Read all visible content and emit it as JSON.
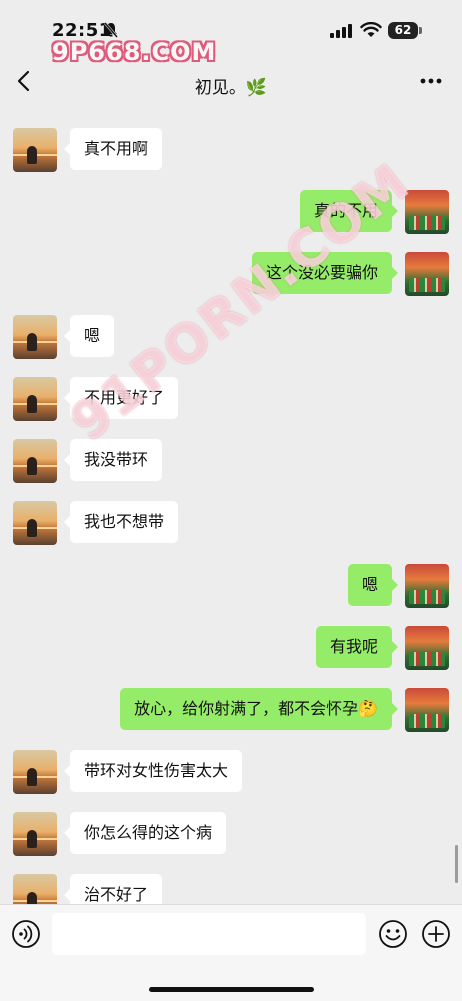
{
  "status_bar": {
    "time": "22:51",
    "battery": "62",
    "watermark": "9P668.COM"
  },
  "nav": {
    "title": "初见。🌿"
  },
  "watermark_diagonal": "91PORN.COM",
  "messages": [
    {
      "side": "left",
      "text": "真不用啊"
    },
    {
      "side": "right",
      "text": "真的不用"
    },
    {
      "side": "right",
      "text": "这个没必要骗你"
    },
    {
      "side": "left",
      "text": "嗯"
    },
    {
      "side": "left",
      "text": "不用更好了"
    },
    {
      "side": "left",
      "text": "我没带环"
    },
    {
      "side": "left",
      "text": "我也不想带"
    },
    {
      "side": "right",
      "text": "嗯"
    },
    {
      "side": "right",
      "text": "有我呢"
    },
    {
      "side": "right",
      "text": "放心，给你射满了，都不会怀孕🤔"
    },
    {
      "side": "left",
      "text": "带环对女性伤害太大"
    },
    {
      "side": "left",
      "text": "你怎么得的这个病"
    },
    {
      "side": "left",
      "text": "治不好了"
    }
  ],
  "input": {
    "value": "",
    "placeholder": ""
  },
  "icons": {
    "back": "chevron-left-icon",
    "more": "more-dots-icon",
    "voice": "voice-icon",
    "emoji": "emoji-icon",
    "plus": "plus-icon"
  },
  "colors": {
    "background": "#ededed",
    "bubble_sent": "#95ec69",
    "bubble_received": "#ffffff"
  }
}
